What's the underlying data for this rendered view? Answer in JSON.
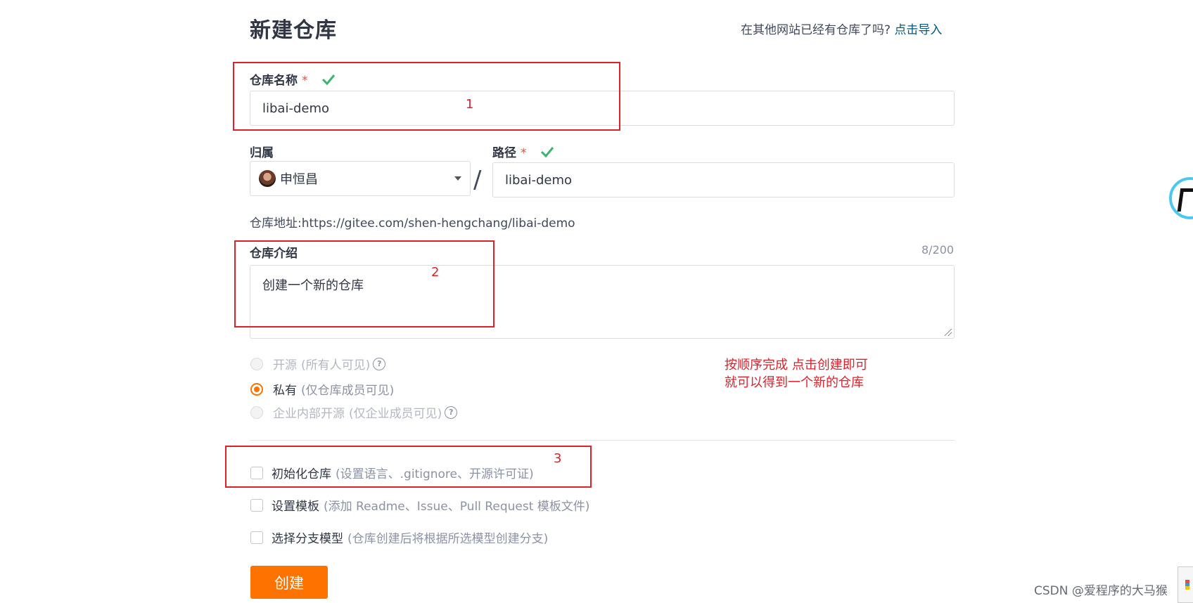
{
  "page": {
    "title": "新建仓库",
    "import_prompt": "在其他网站已经有仓库了吗?",
    "import_link": "点击导入"
  },
  "repo_name": {
    "label": "仓库名称",
    "required_mark": "*",
    "value": "libai-demo",
    "status_icon": "check-icon"
  },
  "owner": {
    "label": "归属",
    "value": "申恒昌",
    "avatar_icon": "avatar"
  },
  "path": {
    "label": "路径",
    "required_mark": "*",
    "separator": "/",
    "value": "libai-demo",
    "status_icon": "check-icon"
  },
  "repo_address": {
    "label": "仓库地址:",
    "url": "https://gitee.com/shen-hengchang/libai-demo"
  },
  "description": {
    "label": "仓库介绍",
    "counter": "8/200",
    "value": "创建一个新的仓库"
  },
  "visibility": {
    "options": [
      {
        "label": "开源",
        "note": "(所有人可见)",
        "selected": false,
        "disabled": true,
        "help": true
      },
      {
        "label": "私有",
        "note": "(仅仓库成员可见)",
        "selected": true,
        "disabled": false,
        "help": false
      },
      {
        "label": "企业内部开源",
        "note": "(仅企业成员可见)",
        "selected": false,
        "disabled": true,
        "help": true
      }
    ],
    "help_glyph": "?",
    "accent_color": "#fe7300"
  },
  "options": [
    {
      "label": "初始化仓库",
      "note": "(设置语言、.gitignore、开源许可证)",
      "checked": false
    },
    {
      "label": "设置模板",
      "note": "(添加 Readme、Issue、Pull Request 模板文件)",
      "checked": false
    },
    {
      "label": "选择分支模型",
      "note": "(仓库创建后将根据所选模型创建分支)",
      "checked": false
    }
  ],
  "create_button": {
    "label": "创建",
    "color": "#fe7300"
  },
  "annotations": {
    "numbers": [
      "1",
      "2",
      "3"
    ],
    "note_line1": "按顺序完成 点击创建即可",
    "note_line2": "就可以得到一个新的仓库",
    "color": "#e0202a"
  },
  "watermark": "CSDN @爱程序的大马猴"
}
